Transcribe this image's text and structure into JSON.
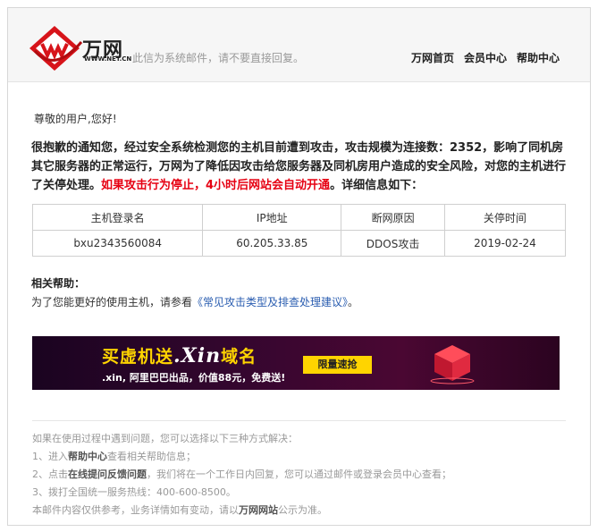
{
  "header": {
    "brand": "万网",
    "brand_sub": "WWW.NET.CN",
    "notice": "此信为系统邮件，请不要直接回复。",
    "nav": [
      "万网首页",
      "会员中心",
      "帮助中心"
    ]
  },
  "greeting": "尊敬的用户,您好!",
  "alert": {
    "part1": "很抱歉的通知您，经过安全系统检测您的主机目前遭到攻击，攻击规模为连接数：2352，影响了同机房其它服务器的正常运行，万网为了降低因攻击给您服务器及同机房用户造成的安全风险，对您的主机进行了关停处理。",
    "highlight": "如果攻击行为停止，4小时后网站会自动开通",
    "part2": "。详细信息如下："
  },
  "table": {
    "headers": [
      "主机登录名",
      "IP地址",
      "断网原因",
      "关停时间"
    ],
    "row": [
      "bxu2343560084",
      "60.205.33.85",
      "DDOS攻击",
      "2019-02-24"
    ]
  },
  "help": {
    "title": "相关帮助：",
    "prefix": "为了您能更好的使用主机，请参看",
    "link": "《常见攻击类型及排查处理建议》",
    "suffix": "。"
  },
  "banner": {
    "title_a": "买虚机送",
    "title_xin": ".Xin",
    "title_b": "域名",
    "sub": ".xin, 阿里巴巴出品，价值88元，免费送!",
    "button": "限量速抢"
  },
  "footer": {
    "line1": "如果在使用过程中遇到问题，您可以选择以下三种方式解决：",
    "line2_a": "1、进入",
    "line2_b": "帮助中心",
    "line2_c": "查看相关帮助信息；",
    "line3_a": "2、点击",
    "line3_b": "在线提问反馈问题",
    "line3_c": "，我们将在一个工作日内回复，您可以通过邮件或登录会员中心查看；",
    "line4": "3、拨打全国统一服务热线：400-600-8500。",
    "line5_a": "本邮件内容仅供参考，业务详情如有变动，请以",
    "line5_b": "万网网站",
    "line5_c": "公示为准。"
  },
  "colors": {
    "alert_red": "#e60012",
    "link_blue": "#2a5db0",
    "banner_yellow": "#ffd400"
  }
}
